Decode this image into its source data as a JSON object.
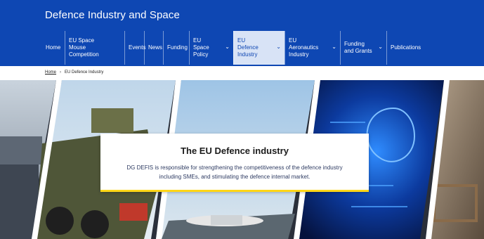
{
  "header": {
    "site_title": "Defence Industry and Space",
    "nav": [
      {
        "label": "Home",
        "has_dropdown": false,
        "active": false
      },
      {
        "label": "EU Space Mouse Competition",
        "has_dropdown": false,
        "active": false
      },
      {
        "label": "Events",
        "has_dropdown": false,
        "active": false
      },
      {
        "label": "News",
        "has_dropdown": false,
        "active": false
      },
      {
        "label": "Funding",
        "has_dropdown": false,
        "active": false
      },
      {
        "label": "EU Space Policy",
        "has_dropdown": true,
        "active": false
      },
      {
        "label": "EU Defence Industry",
        "has_dropdown": true,
        "active": true
      },
      {
        "label": "EU Aeronautics Industry",
        "has_dropdown": true,
        "active": false
      },
      {
        "label": "Funding and Grants",
        "has_dropdown": true,
        "active": false
      },
      {
        "label": "Publications",
        "has_dropdown": false,
        "active": false
      }
    ]
  },
  "breadcrumb": {
    "home": "Home",
    "separator": "›",
    "current": "EU Defence Industry"
  },
  "hero": {
    "title": "The EU Defence industry",
    "description": "DG DEFIS is responsible for strengthening the competitiveness of the defence industry including SMEs, and stimulating the defence internal market."
  },
  "colors": {
    "header_bg": "#0e47b3",
    "active_tab_bg": "#d8e3f6",
    "hero_card_accent": "#ffd617"
  },
  "icons": {
    "nav_dropdown": "chevron-down-icon"
  }
}
